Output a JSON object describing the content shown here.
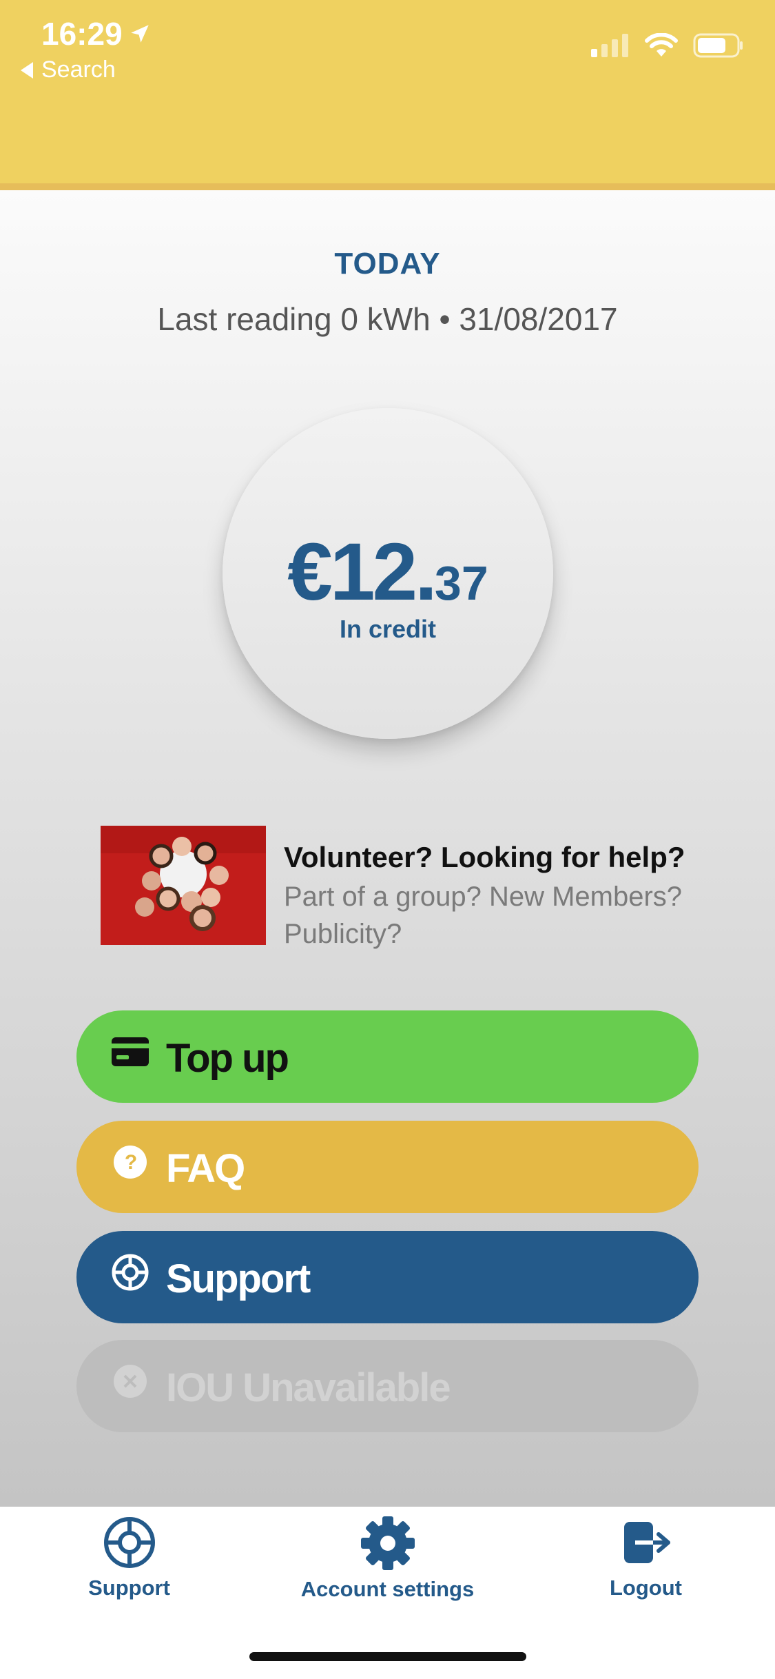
{
  "status_bar": {
    "time": "16:29",
    "back_label": "Search"
  },
  "summary": {
    "heading": "TODAY",
    "last_reading": "Last reading 0 kWh • 31/08/2017"
  },
  "balance": {
    "whole": "€12.",
    "cents": "37",
    "label": "In credit"
  },
  "promo": {
    "title": "Volunteer? Looking for help?",
    "subtitle": "Part of a group? New Members? Publicity?"
  },
  "actions": {
    "topup": "Top up",
    "faq": "FAQ",
    "support": "Support",
    "iou": "IOU Unavailable"
  },
  "tabbar": {
    "support": "Support",
    "account_settings": "Account settings",
    "logout": "Logout"
  },
  "colors": {
    "header": "#efd160",
    "brand_blue": "#245a8a",
    "topup_green": "#68cd4f",
    "faq_yellow": "#e4b946",
    "disabled_grey": "#bdbdbd"
  }
}
